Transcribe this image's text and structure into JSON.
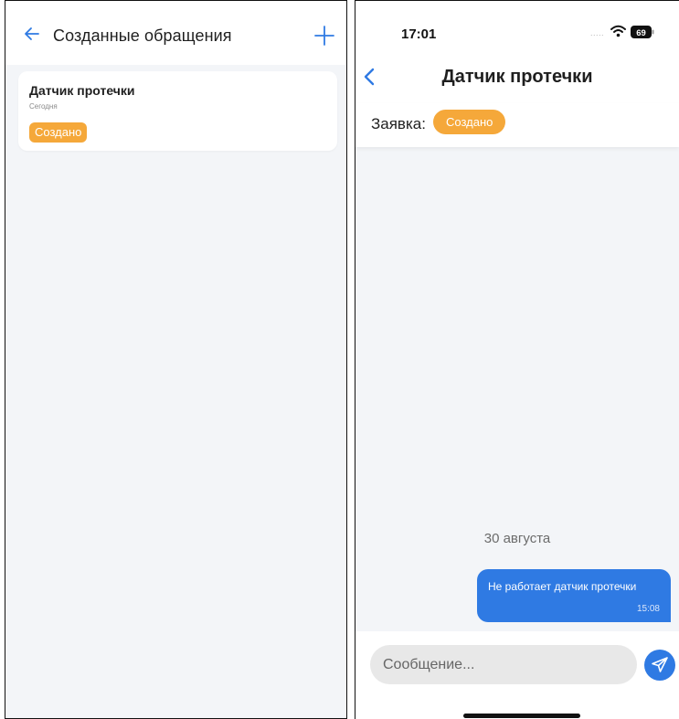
{
  "left_screen": {
    "header": {
      "title": "Созданные обращения",
      "back_icon": "arrow-left-icon",
      "add_icon": "plus-icon"
    },
    "cards": [
      {
        "title": "Датчик протечки",
        "date": "Сегодня",
        "status": "Создано"
      }
    ]
  },
  "right_screen": {
    "status_bar": {
      "time": "17:01",
      "signal": ".....",
      "battery": "69"
    },
    "nav": {
      "title": "Датчик протечки",
      "back_icon": "chevron-left-icon"
    },
    "request": {
      "label": "Заявка:",
      "status": "Создано"
    },
    "chat": {
      "date_separator": "30 августа",
      "messages": [
        {
          "text": "Не работает датчик протечки",
          "time": "15:08"
        }
      ]
    },
    "composer": {
      "placeholder": "Сообщение...",
      "send_icon": "send-icon"
    }
  },
  "colors": {
    "accent_blue": "#2f7ae3",
    "status_orange": "#f5a83a",
    "background": "#f3f5f8"
  }
}
